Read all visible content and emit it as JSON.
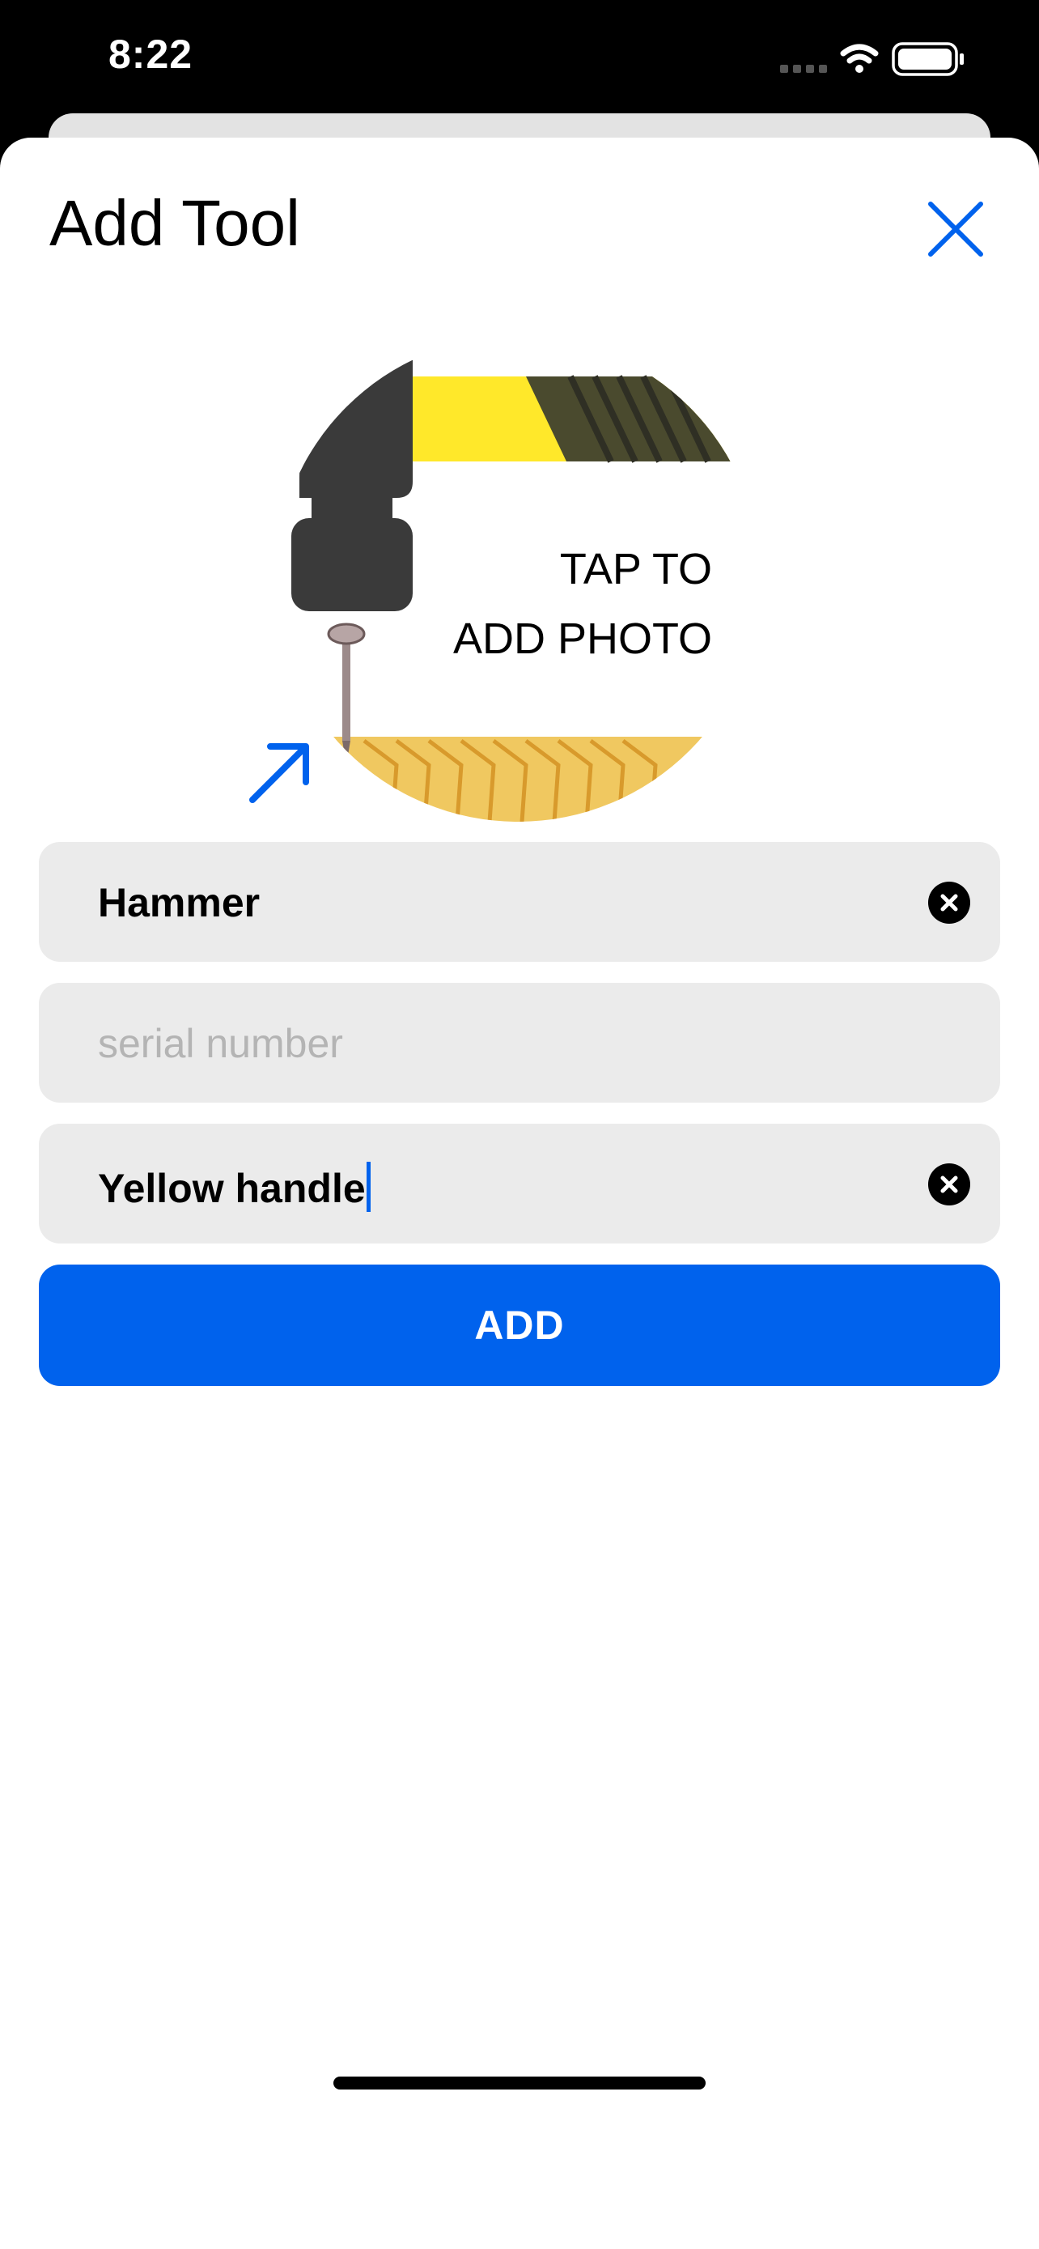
{
  "status_bar": {
    "time": "8:22",
    "icons": [
      "cellular-signal-icon",
      "wifi-icon",
      "battery-icon"
    ]
  },
  "sheet": {
    "title": "Add Tool",
    "close_icon": "close-icon"
  },
  "photo_picker": {
    "label_line1": "TAP TO",
    "label_line2": "ADD PHOTO",
    "illustration": "hammer-and-nail-illustration",
    "hint_icon": "arrow-up-right-icon"
  },
  "form": {
    "name": {
      "value": "Hammer",
      "clear_icon": "clear-icon"
    },
    "serial": {
      "value": "",
      "placeholder": "serial number"
    },
    "description": {
      "value": "Yellow handle",
      "clear_icon": "clear-icon"
    }
  },
  "add_button": {
    "label": "ADD"
  },
  "colors": {
    "accent": "#0062ED",
    "field_background": "#EBEBEB",
    "hammer_dark": "#3A3A3A",
    "tape_yellow": "#FFE82A",
    "wood": "#F0C860"
  }
}
